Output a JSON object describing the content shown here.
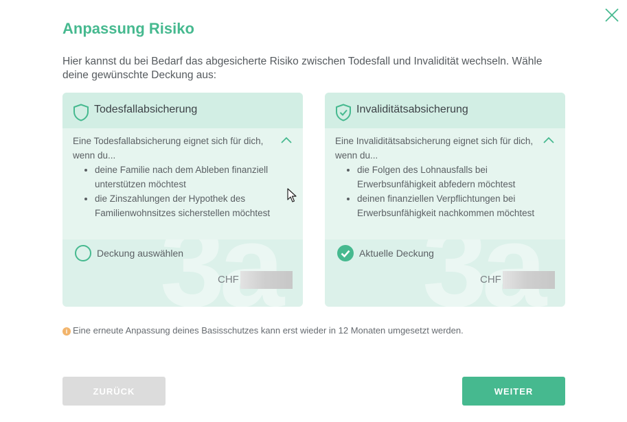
{
  "dialog": {
    "title": "Anpassung Risiko",
    "intro": "Hier kannst du bei Bedarf das abgesicherte Risiko zwischen Todesfall und Invalidität wechseln. Wähle deine gewünschte Deckung aus:"
  },
  "cards": [
    {
      "title": "Todesfallabsicherung",
      "icon": "shield-icon",
      "intro": "Eine Todesfallabsicherung eignet sich für dich, wenn du...",
      "bullets": [
        "deine Familie nach dem Ableben finanziell unterstützen möchtest",
        "die Zinszahlungen der Hypothek des Familienwohnsitzes sicherstellen möchtest"
      ],
      "select_label": "Deckung auswählen",
      "selected": false,
      "currency": "CHF",
      "bg_digit": "3a"
    },
    {
      "title": "Invaliditätsabsicherung",
      "icon": "shield-check-icon",
      "intro": "Eine Invaliditätsabsicherung eignet sich für dich, wenn du...",
      "bullets": [
        "die Folgen des Lohnausfalls bei Erwerbsunfähigkeit abfedern möchtest",
        "deinen finanziellen Verpflichtungen bei Erwerbsunfähigkeit nachkommen möchtest"
      ],
      "select_label": "Aktuelle Deckung",
      "selected": true,
      "currency": "CHF",
      "bg_digit": "3a"
    }
  ],
  "info": {
    "text": "Eine erneute Anpassung deines Basisschutzes kann erst wieder in 12 Monaten umgesetzt werden.",
    "icon": "info-icon"
  },
  "buttons": {
    "back": "ZURÜCK",
    "next": "WEITER"
  },
  "colors": {
    "accent": "#46b98f",
    "card_bg": "#dcf1ea",
    "info": "#f2b46b",
    "disabled": "#dcdcdc"
  }
}
